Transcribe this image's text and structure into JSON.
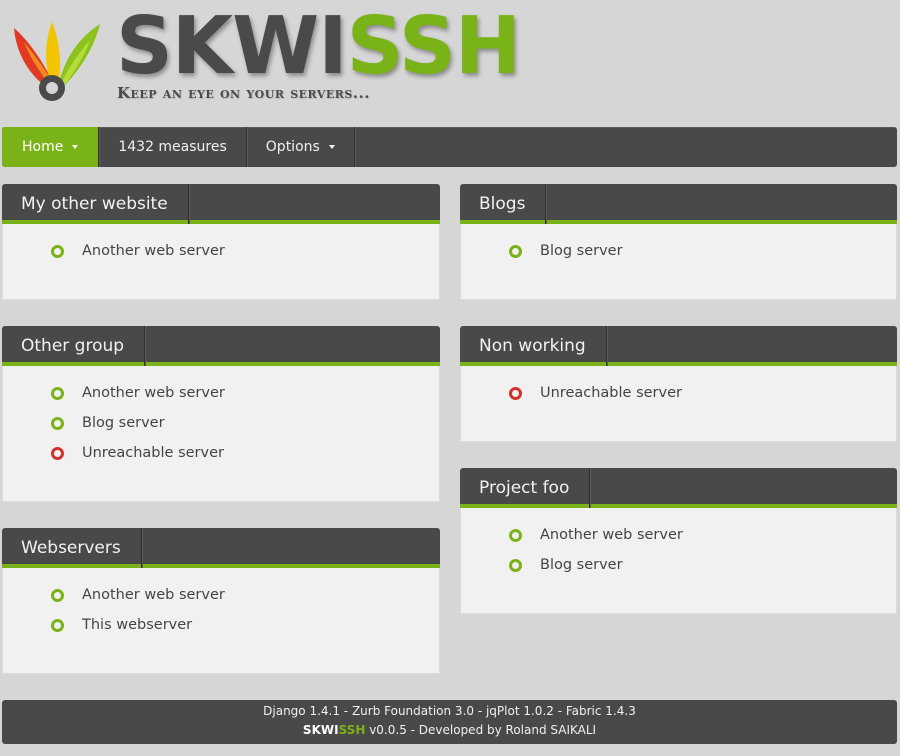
{
  "brand": {
    "logo_part1": "SKWI",
    "logo_part2": "SSH",
    "tagline": "Keep an eye on your servers...",
    "colors": {
      "accent": "#7ab317",
      "dark": "#494949",
      "ok": "#7ab317",
      "error": "#d2322d"
    }
  },
  "nav": {
    "home": "Home",
    "measures": "1432 measures",
    "options": "Options"
  },
  "groups": [
    {
      "title": "My other website",
      "servers": [
        {
          "name": "Another web server",
          "status": "ok"
        }
      ]
    },
    {
      "title": "Other group",
      "servers": [
        {
          "name": "Another web server",
          "status": "ok"
        },
        {
          "name": "Blog server",
          "status": "ok"
        },
        {
          "name": "Unreachable server",
          "status": "error"
        }
      ]
    },
    {
      "title": "Webservers",
      "servers": [
        {
          "name": "Another web server",
          "status": "ok"
        },
        {
          "name": "This webserver",
          "status": "ok"
        }
      ]
    },
    {
      "title": "Blogs",
      "servers": [
        {
          "name": "Blog server",
          "status": "ok"
        }
      ]
    },
    {
      "title": "Non working",
      "servers": [
        {
          "name": "Unreachable server",
          "status": "error"
        }
      ]
    },
    {
      "title": "Project foo",
      "servers": [
        {
          "name": "Another web server",
          "status": "ok"
        },
        {
          "name": "Blog server",
          "status": "ok"
        }
      ]
    }
  ],
  "footer": {
    "credits": "Django 1.4.1 - Zurb Foundation 3.0 - jqPlot 1.0.2 - Fabric 1.4.3",
    "brand1": "SKWI",
    "brand2": "SSH",
    "version_text": " v0.0.5 - Developed by Roland SAIKALI"
  }
}
